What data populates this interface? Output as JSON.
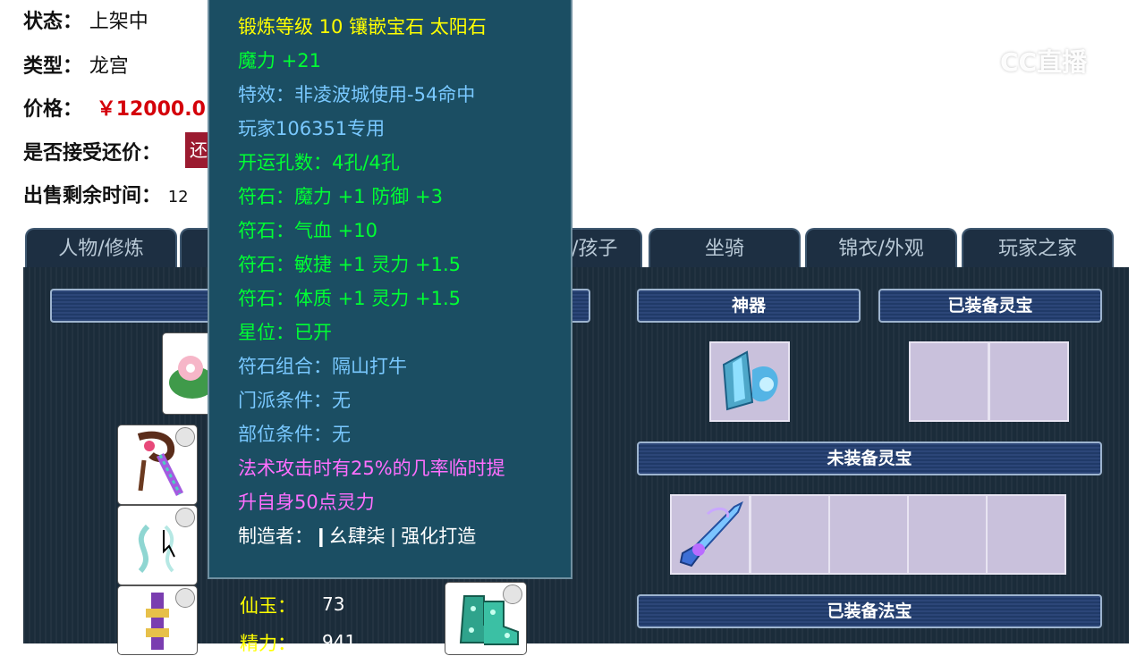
{
  "info": {
    "status_label": "状态：",
    "status_value": "上架中",
    "type_label": "类型：",
    "type_value": "龙宫",
    "price_label": "价格：",
    "price_value": "￥12000.0",
    "counter_label": "是否接受还价：",
    "counter_button": "还",
    "time_label": "出售剩余时间：",
    "time_value": "12"
  },
  "watermark": "CC直播",
  "tabs": [
    "人物/修炼",
    "",
    "/孩子",
    "坐骑",
    "锦衣/外观",
    "玩家之家"
  ],
  "sections": {
    "shenqi": "神器",
    "equipped_lingbao": "已装备灵宝",
    "unequipped_lingbao": "未装备灵宝",
    "equipped_fabao": "已装备法宝"
  },
  "tooltip": {
    "line1": "锻炼等级 10 镶嵌宝石 太阳石",
    "line2": "魔力 +21",
    "line3": "特效：非凌波城使用-54命中",
    "line4": "玩家106351专用",
    "line5": "开运孔数：4孔/4孔",
    "line6": "符石：魔力 +1 防御 +3",
    "line7": "符石：气血 +10",
    "line8": "符石：敏捷 +1 灵力 +1.5",
    "line9": "符石：体质 +1 灵力 +1.5",
    "line10": "星位：已开",
    "line11": "符石组合：隔山打牛",
    "line12": "门派条件：无",
    "line13": "部位条件：无",
    "line14": "法术攻击时有25%的几率临时提",
    "line15": "升自身50点灵力",
    "line16": "制造者：❙幺肆柒❘强化打造"
  },
  "stats": {
    "xianyu_label": "仙玉：",
    "xianyu_value": "73",
    "jingli_label": "精力：",
    "jingli_value": "941"
  }
}
